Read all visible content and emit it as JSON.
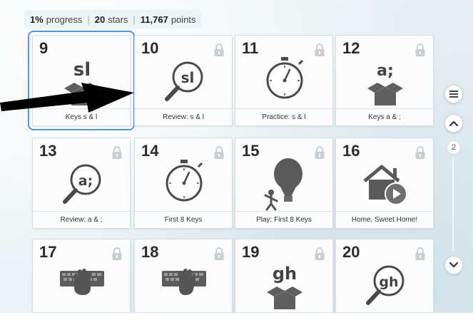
{
  "stats": {
    "progress_value": "1%",
    "progress_label": "progress",
    "stars_value": "20",
    "stars_label": "stars",
    "points_value": "11,767",
    "points_label": "points"
  },
  "lessons": [
    {
      "number": "9",
      "label": "Keys s & l",
      "icon": "box-keys-icon",
      "art_text": "sl",
      "locked": false,
      "selected": true
    },
    {
      "number": "10",
      "label": "Review: s & l",
      "icon": "magnifier-icon",
      "art_text": "sl",
      "locked": true
    },
    {
      "number": "11",
      "label": "Practice: s & l",
      "icon": "stopwatch-icon",
      "art_text": "",
      "locked": true
    },
    {
      "number": "12",
      "label": "Keys a & ;",
      "icon": "box-keys-icon",
      "art_text": "a;",
      "locked": true
    },
    {
      "number": "13",
      "label": "Review: a & ;",
      "icon": "magnifier-icon",
      "art_text": "a;",
      "locked": true
    },
    {
      "number": "14",
      "label": "First 8 Keys",
      "icon": "stopwatch-icon",
      "art_text": "",
      "locked": true
    },
    {
      "number": "15",
      "label": "Play: First 8 Keys",
      "icon": "balloon-game-icon",
      "art_text": "",
      "locked": true
    },
    {
      "number": "16",
      "label": "Home, Sweet Home!",
      "icon": "house-video-icon",
      "art_text": "",
      "locked": true
    },
    {
      "number": "17",
      "label": "",
      "icon": "keyboard-hand-icon",
      "art_text": "",
      "locked": true
    },
    {
      "number": "18",
      "label": "",
      "icon": "keyboard-hand-icon",
      "art_text": "",
      "locked": true
    },
    {
      "number": "19",
      "label": "",
      "icon": "box-keys-icon",
      "art_text": "gh",
      "locked": true
    },
    {
      "number": "20",
      "label": "",
      "icon": "magnifier-icon",
      "art_text": "gh",
      "locked": true
    }
  ],
  "sidebar": {
    "menu_icon": "menu-icon",
    "up_icon": "chevron-up-icon",
    "down_icon": "chevron-down-icon",
    "page_number": "2"
  },
  "colors": {
    "selection_outline": "#4c97e6",
    "icon_stroke": "#4a4a4a",
    "art_gray": "#5f5f5f"
  }
}
